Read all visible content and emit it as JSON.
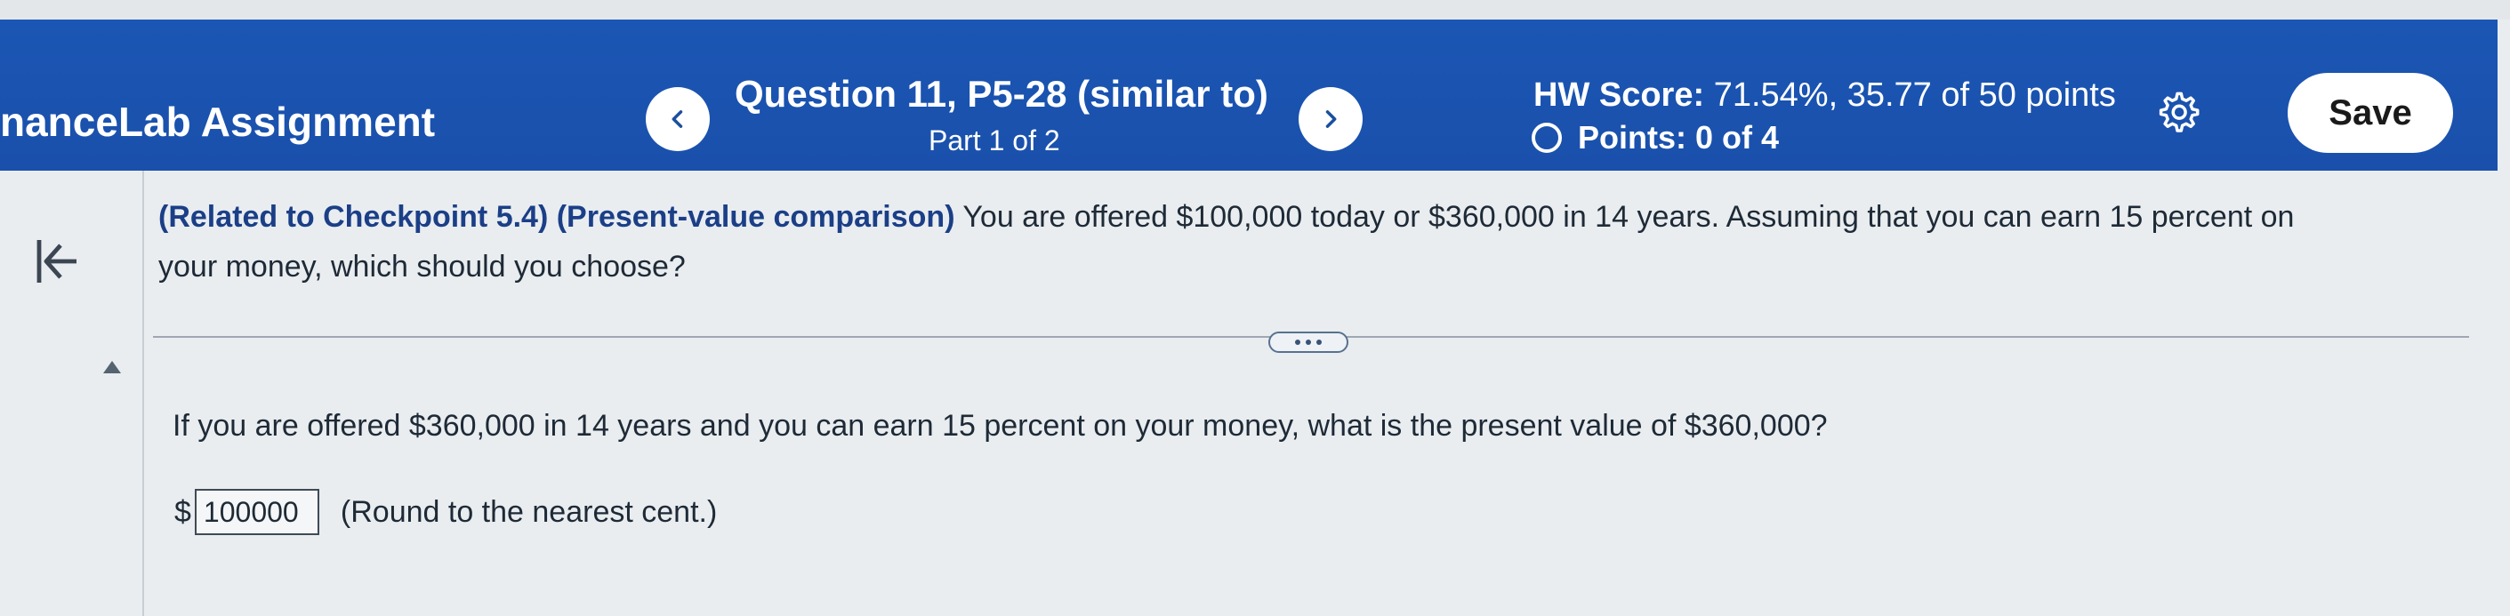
{
  "header": {
    "app_title": "nanceLab Assignment",
    "question_title": "Question 11, P5-28 (similar to)",
    "question_part": "Part 1 of 2",
    "hw_score_label": "HW Score:",
    "hw_score_value": "71.54%, 35.77 of 50 points",
    "points_label": "Points: 0 of 4",
    "save_label": "Save"
  },
  "icons": {
    "prev": "chevron-left-icon",
    "next": "chevron-right-icon",
    "settings": "gear-icon",
    "collapse": "collapse-left-icon",
    "more": "more-icon",
    "points_status": "circle-outline-icon"
  },
  "problem": {
    "reference": "(Related to Checkpoint 5.4) (Present-value comparison)",
    "text": " You are offered $100,000 today or $360,000 in 14 years. Assuming that you can earn 15 percent on your money, which should you choose?"
  },
  "part1": {
    "question": "If you are offered $360,000 in 14 years and you can earn 15 percent on your money, what is the present value of $360,000?",
    "currency": "$",
    "answer_value": "100000",
    "hint": "(Round to the nearest cent.)"
  },
  "colors": {
    "header_bg": "#1b56b4",
    "page_bg": "#e9edf0",
    "reference_text": "#1b3f87"
  }
}
